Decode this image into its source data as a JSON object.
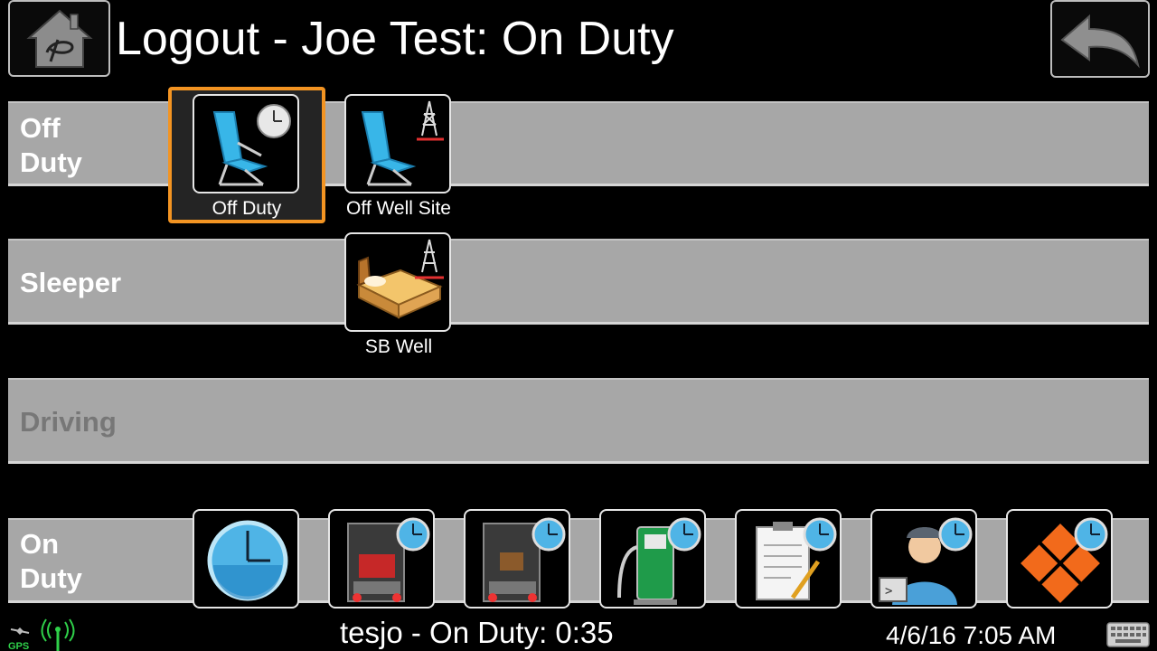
{
  "header": {
    "title": "Logout - Joe Test: On Duty",
    "home_icon": "home-logo-icon",
    "back_icon": "back-arrow-icon"
  },
  "rows": {
    "off_duty": {
      "label": "Off\nDuty"
    },
    "sleeper": {
      "label": "Sleeper"
    },
    "driving": {
      "label": "Driving"
    },
    "on_duty": {
      "label": "On\nDuty"
    }
  },
  "tiles": {
    "off_duty": {
      "caption": "Off Duty",
      "icon": "beach-chair-clock-icon",
      "selected": true
    },
    "off_well_site": {
      "caption": "Off Well Site",
      "icon": "beach-chair-oil-rig-icon"
    },
    "sb_well": {
      "caption": "SB Well",
      "icon": "bed-oil-rig-icon"
    },
    "on_duty_icons": [
      "clock-icon",
      "truck-loading-clock-icon",
      "truck-unloading-clock-icon",
      "fuel-pump-clock-icon",
      "clipboard-inspection-clock-icon",
      "driver-console-clock-icon",
      "orange-diamond-clock-icon"
    ]
  },
  "footer": {
    "status": "tesjo - On Duty: 0:35",
    "datetime": "4/6/16 7:05 AM",
    "gps_label": "GPS"
  },
  "colors": {
    "selected_border": "#f39422",
    "row_background": "#a7a7a7",
    "disabled_label": "#777777",
    "clock_blue": "#4fb4e6"
  }
}
